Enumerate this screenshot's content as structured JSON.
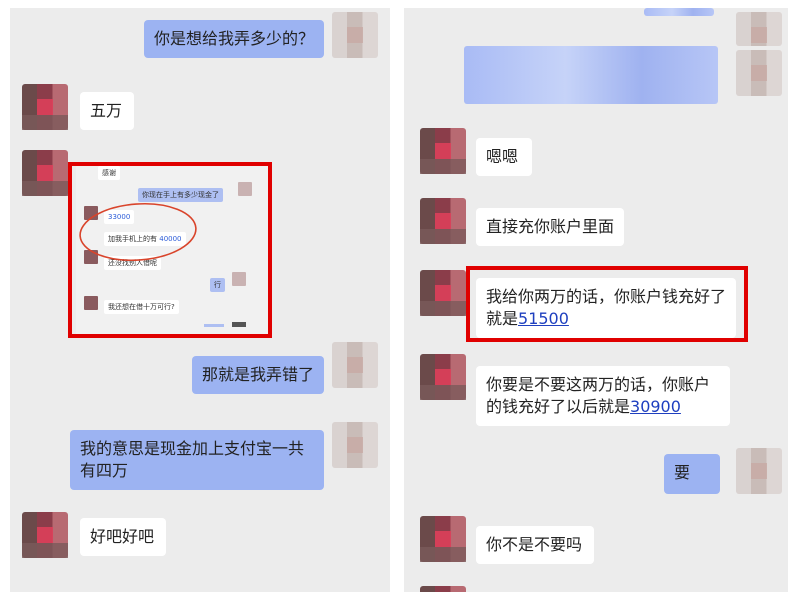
{
  "left": {
    "messages": [
      {
        "side": "out",
        "text": "你是想给我弄多少的？"
      },
      {
        "side": "in",
        "text": "五万"
      },
      {
        "side": "out",
        "text": "那就是我弄错了"
      },
      {
        "side": "out",
        "text": "我的意思是现金加上支付宝一共有四万"
      },
      {
        "side": "in",
        "text": "好吧好吧"
      }
    ],
    "embedded_screenshot": {
      "top_cut": "感谢",
      "messages": [
        {
          "side": "out",
          "text": "你现在手上有多少现金了"
        },
        {
          "side": "in",
          "text": "33000"
        },
        {
          "side": "in",
          "prefix": "加我手机上的有 ",
          "value": "40000"
        },
        {
          "side": "in",
          "text": "还没找别人借呢"
        },
        {
          "side": "out",
          "text": "行"
        },
        {
          "side": "in",
          "text": "我还想在借十万可行?"
        }
      ]
    }
  },
  "right": {
    "messages": [
      {
        "side": "in",
        "text": "嗯嗯"
      },
      {
        "side": "in",
        "text": "直接充你账户里面"
      },
      {
        "side": "in",
        "prefix": "我给你两万的话，你账户钱充好了就是",
        "value": "51500"
      },
      {
        "side": "in",
        "prefix": "你要是不要这两万的话，你账户的钱充好了以后就是",
        "value": "30900"
      },
      {
        "side": "out",
        "text": "要"
      },
      {
        "side": "in",
        "text": "你不是不要吗"
      }
    ]
  },
  "colors": {
    "background": "#ececec",
    "outgoing_bubble": "#9cb3f2",
    "incoming_bubble": "#ffffff",
    "highlight_box": "#e00000",
    "link": "#1e3fbf",
    "circle_annotation": "#d9442b"
  }
}
